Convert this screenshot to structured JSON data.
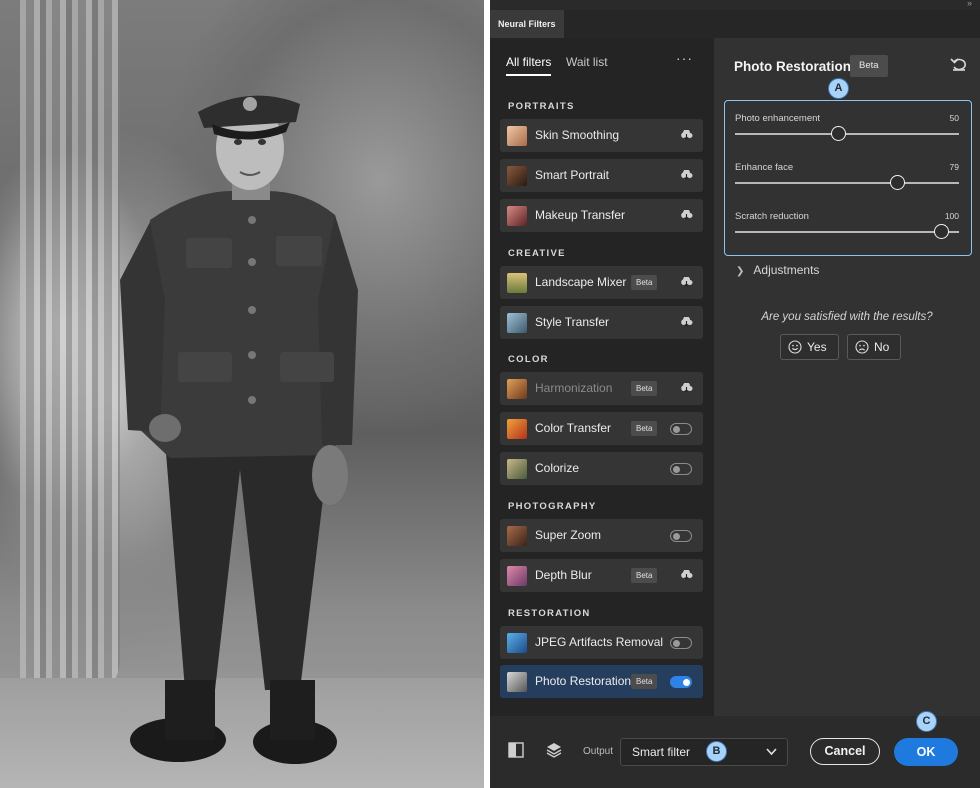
{
  "panel": {
    "tab_title": "Neural Filters",
    "collapse_glyph": "»",
    "tabs": [
      {
        "label": "All filters",
        "active": true
      },
      {
        "label": "Wait list",
        "active": false
      }
    ],
    "more_glyph": "···"
  },
  "categories": [
    {
      "title": "PORTRAITS",
      "items": [
        {
          "label": "Skin Smoothing",
          "badge": "",
          "control": "cloud-download-icon"
        },
        {
          "label": "Smart Portrait",
          "badge": "",
          "control": "cloud-download-icon"
        },
        {
          "label": "Makeup Transfer",
          "badge": "",
          "control": "cloud-download-icon"
        }
      ]
    },
    {
      "title": "CREATIVE",
      "items": [
        {
          "label": "Landscape Mixer",
          "badge": "Beta",
          "control": "cloud-download-icon"
        },
        {
          "label": "Style Transfer",
          "badge": "",
          "control": "cloud-download-icon"
        }
      ]
    },
    {
      "title": "COLOR",
      "items": [
        {
          "label": "Harmonization",
          "badge": "Beta",
          "control": "cloud-download-icon",
          "dimmed": true
        },
        {
          "label": "Color Transfer",
          "badge": "Beta",
          "control": "toggle",
          "on": false
        },
        {
          "label": "Colorize",
          "badge": "",
          "control": "toggle",
          "on": false
        }
      ]
    },
    {
      "title": "PHOTOGRAPHY",
      "items": [
        {
          "label": "Super Zoom",
          "badge": "",
          "control": "toggle",
          "on": false
        },
        {
          "label": "Depth Blur",
          "badge": "Beta",
          "control": "cloud-download-icon"
        }
      ]
    },
    {
      "title": "RESTORATION",
      "items": [
        {
          "label": "JPEG Artifacts Removal",
          "badge": "",
          "control": "toggle",
          "on": false
        },
        {
          "label": "Photo Restoration",
          "badge": "Beta",
          "control": "toggle",
          "on": true,
          "selected": true
        }
      ]
    }
  ],
  "detail": {
    "title": "Photo Restoration",
    "badge": "Beta",
    "sliders": [
      {
        "label": "Photo enhancement",
        "value": "50",
        "level": 50
      },
      {
        "label": "Enhance face",
        "value": "79",
        "level": 79
      },
      {
        "label": "Scratch reduction",
        "value": "100",
        "level": 100
      }
    ],
    "adjustments_label": "Adjustments",
    "feedback_question": "Are you satisfied with the results?",
    "yes_label": "Yes",
    "no_label": "No"
  },
  "callouts": {
    "a": "A",
    "b": "B",
    "c": "C"
  },
  "bottom": {
    "output_label": "Output",
    "output_value": "Smart filter",
    "cancel_label": "Cancel",
    "ok_label": "OK"
  },
  "colors": {
    "accent": "#1f7ae0",
    "panel_bg": "#323232",
    "list_bg": "#242424",
    "selected_row": "#263e5e",
    "callout_fill": "#a9d2f7"
  }
}
